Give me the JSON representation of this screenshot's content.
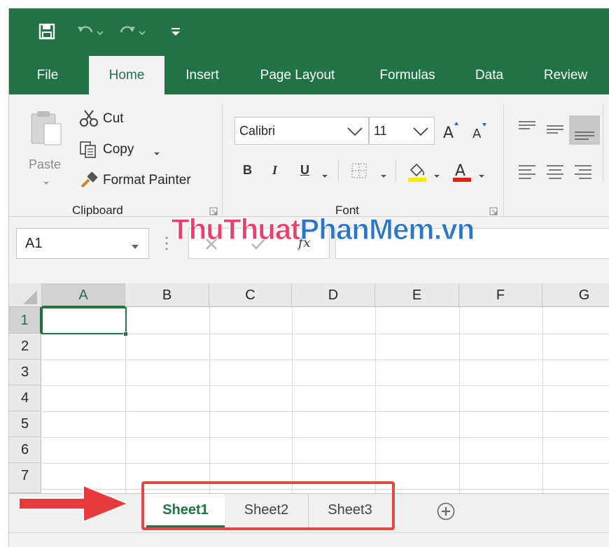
{
  "tabs": [
    "File",
    "Home",
    "Insert",
    "Page Layout",
    "Formulas",
    "Data",
    "Review"
  ],
  "clipboard": {
    "paste_label": "Paste",
    "cut_label": "Cut",
    "copy_label": "Copy",
    "format_painter_label": "Format Painter",
    "group_label": "Clipboard"
  },
  "font": {
    "name": "Calibri",
    "size": "11",
    "bold": "B",
    "italic": "I",
    "underline": "U",
    "group_label": "Font"
  },
  "formula_bar": {
    "name_box": "A1",
    "fx": "fx"
  },
  "grid": {
    "columns": [
      "A",
      "B",
      "C",
      "D",
      "E",
      "F",
      "G"
    ],
    "rows": [
      "1",
      "2",
      "3",
      "4",
      "5",
      "6",
      "7"
    ],
    "selected_cell": "A1"
  },
  "sheets": [
    "Sheet1",
    "Sheet2",
    "Sheet3"
  ],
  "active_sheet": "Sheet1",
  "watermark": {
    "part1": "ThuThuat",
    "part2": "PhanMem.vn"
  },
  "colors": {
    "accent": "#217346",
    "highlight_box": "#e04848",
    "arrow": "#e73c3c"
  }
}
